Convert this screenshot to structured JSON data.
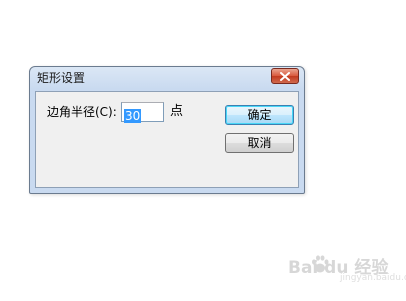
{
  "dialog": {
    "title": "矩形设置",
    "field_label": "边角半径(C):",
    "radius_value": "30",
    "unit": "点",
    "ok_label": "确定",
    "cancel_label": "取消"
  },
  "watermark": {
    "text": "Bai du 经验",
    "sub": "jingyan.baidu.com"
  },
  "colors": {
    "frame": "#c9daf0",
    "client": "#f0f0f0",
    "close": "#c23a1f",
    "selection": "#3399ff"
  },
  "icons": [
    "close-icon",
    "paw-icon"
  ]
}
